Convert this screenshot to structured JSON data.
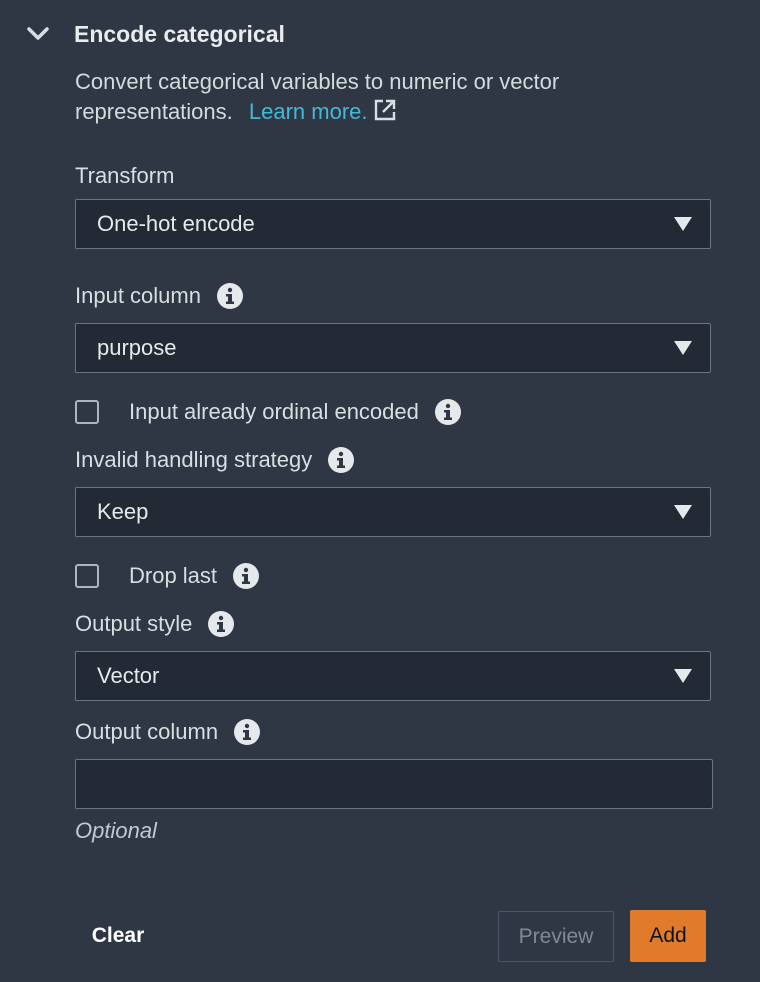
{
  "panel": {
    "title": "Encode categorical",
    "description": "Convert categorical variables to numeric or vector representations.",
    "learn_more": "Learn more."
  },
  "fields": {
    "transform": {
      "label": "Transform",
      "value": "One-hot encode"
    },
    "input_column": {
      "label": "Input column",
      "value": "purpose"
    },
    "input_ordinal": {
      "label": "Input already ordinal encoded",
      "checked": false
    },
    "invalid_handling": {
      "label": "Invalid handling strategy",
      "value": "Keep"
    },
    "drop_last": {
      "label": "Drop last",
      "checked": false
    },
    "output_style": {
      "label": "Output style",
      "value": "Vector"
    },
    "output_column": {
      "label": "Output column",
      "value": "",
      "hint": "Optional"
    }
  },
  "buttons": {
    "clear": "Clear",
    "preview": "Preview",
    "add": "Add"
  },
  "colors": {
    "background": "#2f3745",
    "input_bg": "#232a35",
    "link": "#44b9d6",
    "primary": "#e07b2b"
  }
}
